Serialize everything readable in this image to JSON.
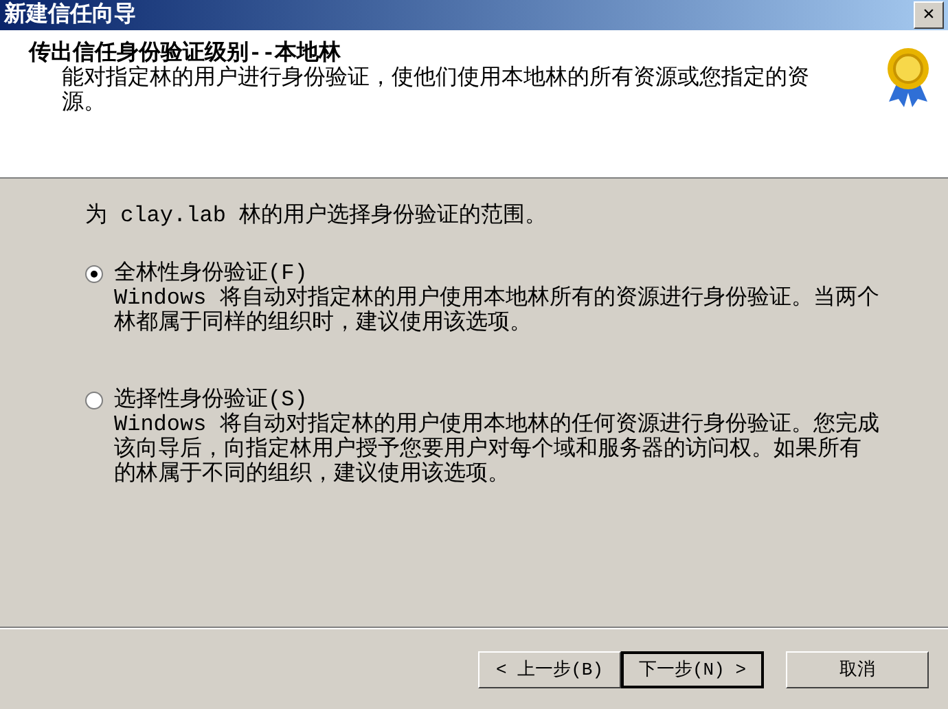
{
  "window": {
    "title": "新建信任向导",
    "close": "✕"
  },
  "header": {
    "title": "传出信任身份验证级别--本地林",
    "description": "能对指定林的用户进行身份验证，使他们使用本地林的所有资源或您指定的资源。"
  },
  "prompt": "为 clay.lab 林的用户选择身份验证的范围。",
  "options": [
    {
      "label": "全林性身份验证(F)",
      "description": "Windows 将自动对指定林的用户使用本地林所有的资源进行身份验证。当两个林都属于同样的组织时，建议使用该选项。",
      "selected": true
    },
    {
      "label": "选择性身份验证(S)",
      "description": "Windows 将自动对指定林的用户使用本地林的任何资源进行身份验证。您完成该向导后，向指定林用户授予您要用户对每个域和服务器的访问权。如果所有的林属于不同的组织，建议使用该选项。",
      "selected": false
    }
  ],
  "buttons": [
    {
      "label": "< 上一步(B)",
      "default": false
    },
    {
      "label": "下一步(N) >",
      "default": true
    },
    {
      "label": "取消",
      "default": false
    }
  ]
}
